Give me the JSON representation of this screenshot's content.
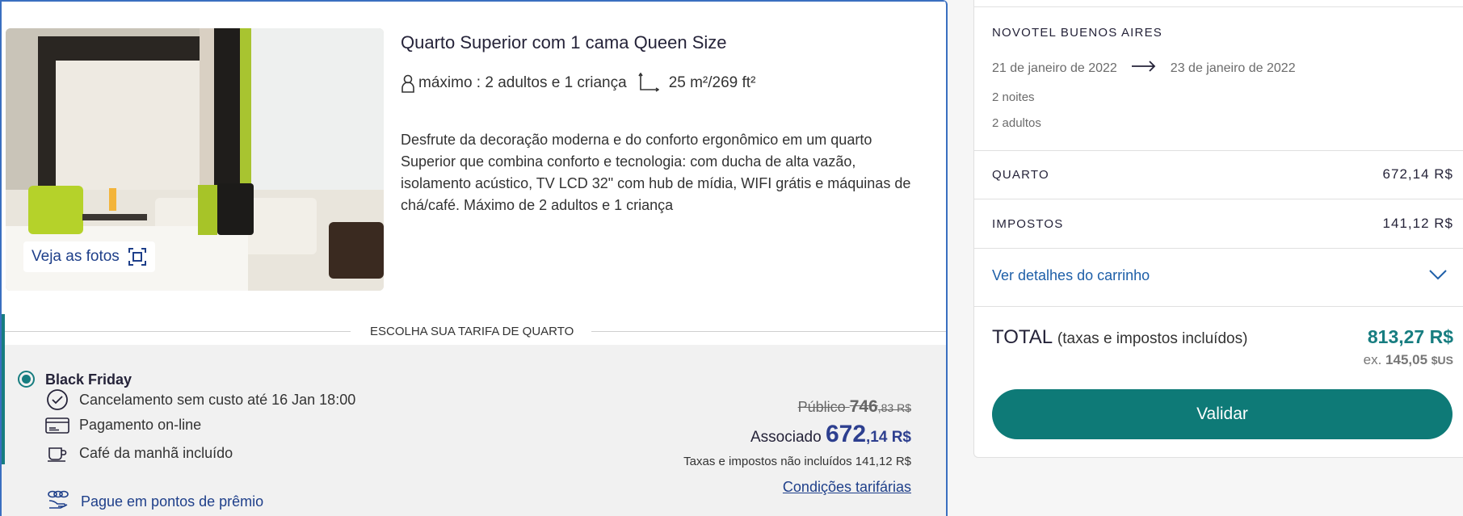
{
  "room": {
    "title": "Quarto Superior com 1 cama Queen Size",
    "capacity": "máximo : 2 adultos e 1 criança",
    "size": "25 m²/269 ft²",
    "description": "Desfrute da decoração moderna e do conforto ergonômico em um quarto Superior que combina conforto e tecnologia: com ducha de alta vazão, isolamento acústico, TV LCD 32\" com hub de mídia, WIFI grátis e máquinas de chá/café. Máximo de 2 adultos e 1 criança",
    "photos_button": "Veja as fotos"
  },
  "rate_section": {
    "heading": "ESCOLHA SUA TARIFA DE QUARTO",
    "rate_name": "Black Friday",
    "features": [
      "Cancelamento sem custo até 16 Jan 18:00",
      "Pagamento on-line",
      "Café da manhã incluído"
    ],
    "points_link": "Pague em pontos de prêmio",
    "public_label": "Público",
    "public_price_int": "746",
    "public_price_dec": ",83 R$",
    "member_label": "Associado",
    "member_price_int": "672",
    "member_price_dec": ",14 R$",
    "taxes_note": "Taxas e impostos não incluídos 141,12 R$",
    "conditions_link": "Condições tarifárias"
  },
  "summary": {
    "hotel": "NOVOTEL BUENOS AIRES",
    "checkin": "21 de janeiro de 2022",
    "checkout": "23 de janeiro de 2022",
    "nights": "2 noites",
    "adults": "2 adultos",
    "room_label": "QUARTO",
    "room_value": "672,14 R$",
    "taxes_label": "IMPOSTOS",
    "taxes_value": "141,12 R$",
    "cart_link": "Ver detalhes do carrinho",
    "total_label": "TOTAL",
    "total_note": "(taxas e impostos incluídos)",
    "total_value": "813,27 R$",
    "total_ex_prefix": "ex.",
    "total_ex_value": "145,05",
    "total_ex_currency": "$US",
    "validate_button": "Validar"
  },
  "colors": {
    "accent_teal": "#0e7a77",
    "link_blue": "#1e3f8a",
    "price_blue": "#2d3f8f",
    "card_border": "#3a6fc0"
  },
  "icons": {
    "capacity": "person-icon",
    "size": "room-size-icon",
    "photos": "gallery-icon",
    "cancel": "clock-icon",
    "payment": "credit-card-icon",
    "breakfast": "coffee-cup-icon",
    "points": "coins-icon",
    "arrow": "arrow-right-icon",
    "chevron": "chevron-down-icon"
  }
}
